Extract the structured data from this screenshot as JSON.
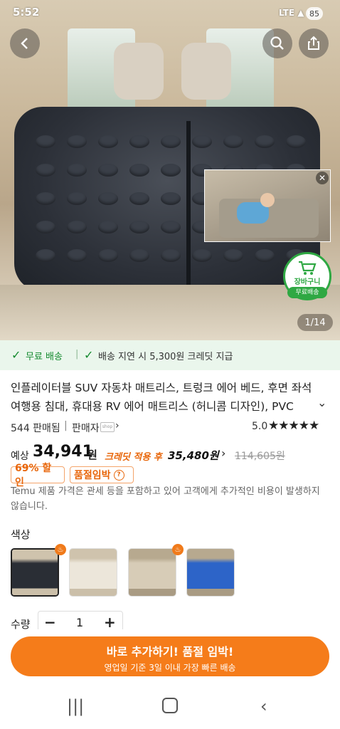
{
  "status_bar": {
    "time": "5:52",
    "battery": "85"
  },
  "hero": {
    "counter": "1/14",
    "cart_badge_label": "장바구니",
    "cart_badge_sub": "무료배송"
  },
  "shipping": {
    "free_shipping": "무료 배송",
    "delay_credit": "배송 지연 시 5,300원 크레딧 지급"
  },
  "product": {
    "title": "인플레이터블 SUV 자동차 매트리스, 트렁크 에어 베드, 후면 좌석 여행용 침대, 휴대용 RV 에어 매트리스 (허니콤 디자인), PVC",
    "sold": "544 판매됨",
    "seller_label": "판매자",
    "rating": "5.0"
  },
  "price": {
    "prefix": "예상",
    "amount": "34,941",
    "unit": "원",
    "credit_label": "크레딧 적용 후",
    "credit_price": "35,480원",
    "original": "114,605원",
    "discount_tag": "69% 할인",
    "soldout_tag": "품절임박",
    "notice": "Temu 제품 가격은 관세 등을 포함하고 있어 고객에게 추가적인 비용이 발생하지 않습니다."
  },
  "color": {
    "label": "색상",
    "options": [
      "black",
      "beige",
      "grey-beige",
      "blue"
    ]
  },
  "quantity": {
    "label": "수량",
    "value": "1",
    "minus": "−",
    "plus": "+"
  },
  "cta": {
    "main": "바로 추가하기! 품절 임박!",
    "sub": "영업일 기준 3일 이내 가장 빠른 배송"
  },
  "colors": {
    "accent": "#f57c1a",
    "green": "#138a2e",
    "orange_text": "#e8660a"
  }
}
